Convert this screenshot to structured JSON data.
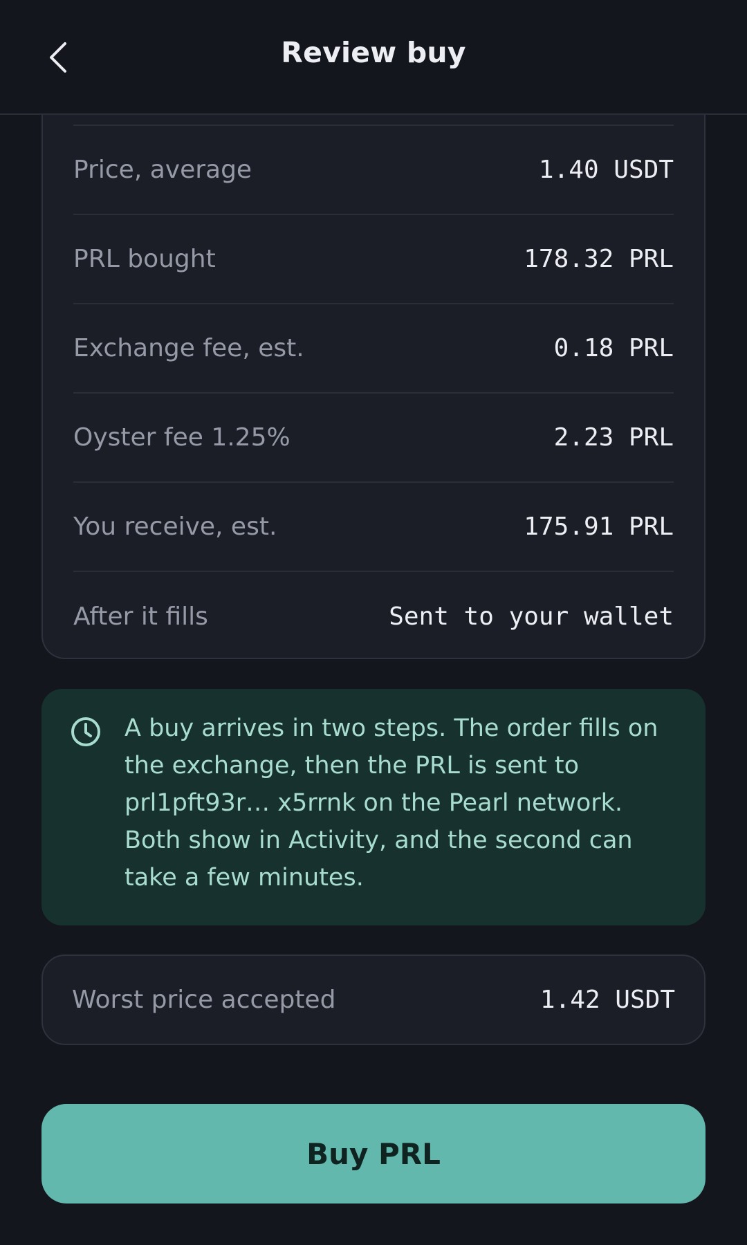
{
  "header": {
    "title": "Review buy",
    "back_icon": "chevron-left-icon"
  },
  "summary": {
    "rows": [
      {
        "label": "Price, average",
        "value": "1.40 USDT"
      },
      {
        "label": "PRL bought",
        "value": "178.32 PRL"
      },
      {
        "label": "Exchange fee, est.",
        "value": "0.18 PRL"
      },
      {
        "label": "Oyster fee 1.25%",
        "value": "2.23 PRL"
      },
      {
        "label": "You receive, est.",
        "value": "175.91 PRL"
      },
      {
        "label": "After it fills",
        "value": "Sent to your wallet"
      }
    ]
  },
  "info_note": {
    "icon": "clock-icon",
    "text": "A buy arrives in two steps. The order fills on the exchange, then the PRL is sent to prl1pft93r… x5rrnk on the Pearl network. Both show in Activity, and the second can take a few minutes."
  },
  "worst_price": {
    "label": "Worst price accepted",
    "value": "1.42 USDT"
  },
  "buy_button": {
    "label": "Buy PRL"
  },
  "colors": {
    "background": "#14161d",
    "card": "#1b1e27",
    "note_background": "#17322e",
    "note_text": "#a7dccf",
    "accent": "#63b8ae"
  }
}
